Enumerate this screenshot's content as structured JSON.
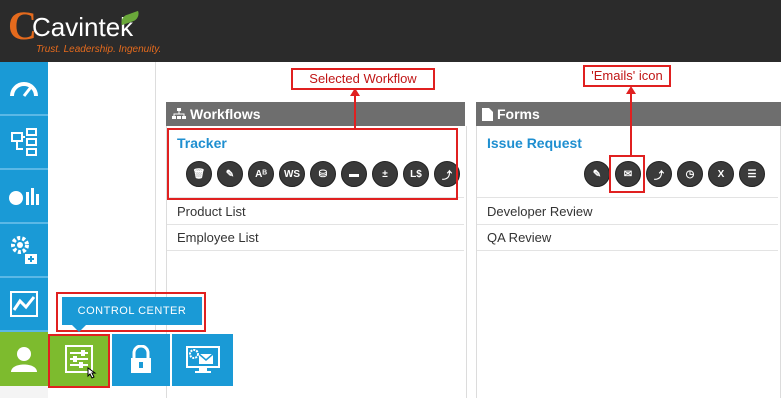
{
  "brand": {
    "name": "Cavintek",
    "tagline": "Trust. Leadership. Ingenuity."
  },
  "sidenav": {
    "items": [
      {
        "name": "dashboard",
        "icon": "gauge-icon"
      },
      {
        "name": "workflow",
        "icon": "flowchart-icon"
      },
      {
        "name": "reports",
        "icon": "pie-bar-chart-icon"
      },
      {
        "name": "settings",
        "icon": "gears-add-icon"
      },
      {
        "name": "analytics",
        "icon": "line-chart-icon"
      },
      {
        "name": "user",
        "icon": "user-icon"
      }
    ]
  },
  "control_center": {
    "tooltip": "CONTROL CENTER",
    "buttons": [
      {
        "name": "control-center",
        "icon": "sliders-icon"
      },
      {
        "name": "lock",
        "icon": "lock-icon"
      },
      {
        "name": "email-settings",
        "icon": "monitor-email-gear-icon"
      }
    ]
  },
  "workflows": {
    "header": "Workflows",
    "selected": "Tracker",
    "icons": [
      {
        "name": "delete",
        "glyph": "🗑"
      },
      {
        "name": "edit",
        "glyph": "✎"
      },
      {
        "name": "rename",
        "glyph": "Aᴮ"
      },
      {
        "name": "web-service",
        "glyph": "WS"
      },
      {
        "name": "database",
        "glyph": "⛁"
      },
      {
        "name": "layout",
        "glyph": "▬"
      },
      {
        "name": "formula",
        "glyph": "±"
      },
      {
        "name": "currency",
        "glyph": "L$"
      },
      {
        "name": "branch",
        "glyph": "⤴"
      }
    ],
    "items": [
      "Product List",
      "Employee List"
    ]
  },
  "forms": {
    "header": "Forms",
    "selected": "Issue Request",
    "icons": [
      {
        "name": "edit",
        "glyph": "✎"
      },
      {
        "name": "emails",
        "glyph": "✉"
      },
      {
        "name": "branch",
        "glyph": "⤴"
      },
      {
        "name": "clock",
        "glyph": "◷"
      },
      {
        "name": "excel",
        "glyph": "X"
      },
      {
        "name": "message",
        "glyph": "☰"
      }
    ],
    "items": [
      "Developer Review",
      "QA Review"
    ]
  },
  "annotations": {
    "selected_workflow": "Selected Workflow",
    "emails_icon": "'Emails' icon"
  },
  "colors": {
    "nav_blue": "#1a9ad6",
    "active_green": "#7dbb2e",
    "header_gray": "#6e6e6e",
    "link_blue": "#1f8fd0",
    "annotation_red": "#e02020"
  }
}
